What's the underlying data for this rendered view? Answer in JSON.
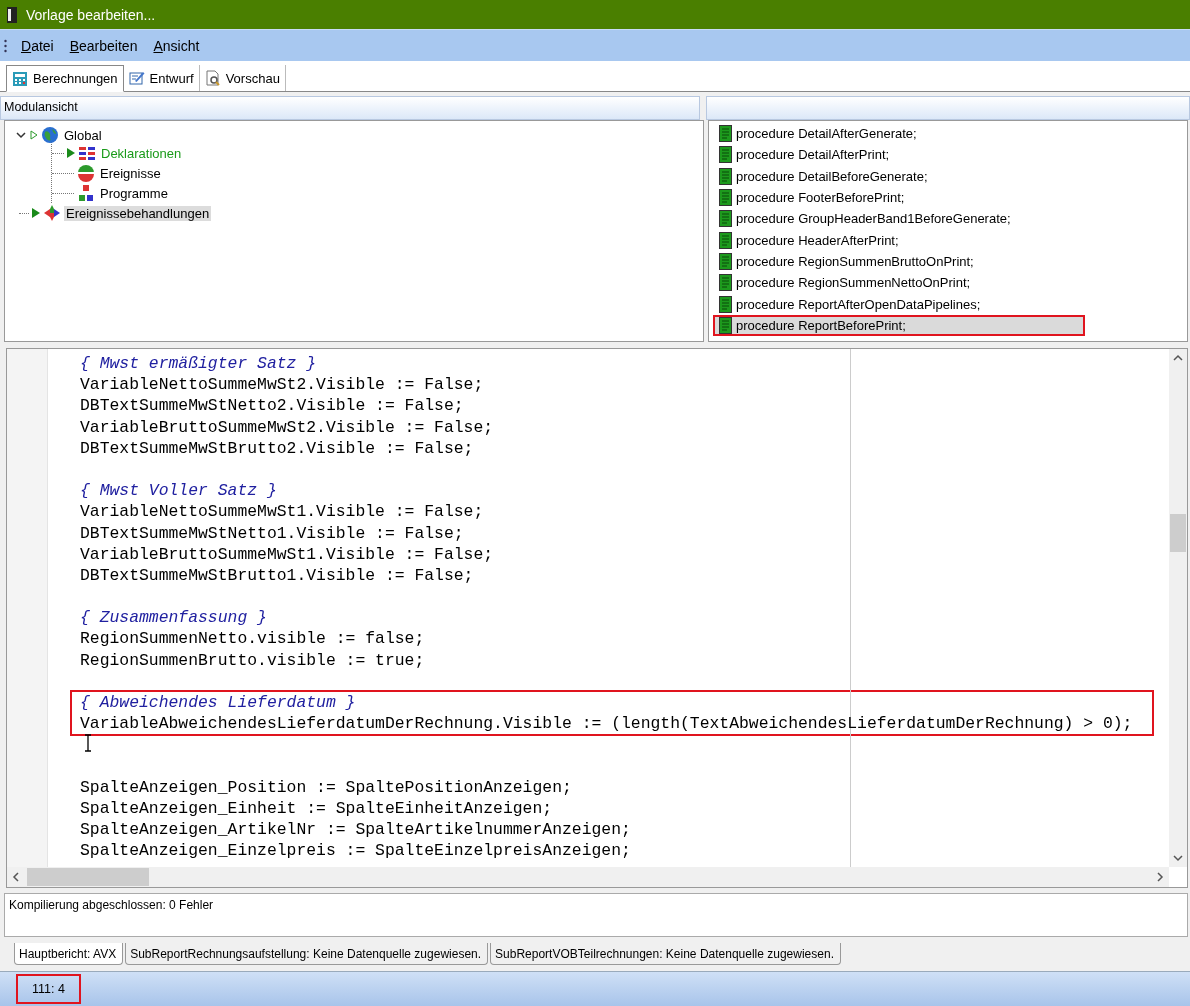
{
  "window": {
    "title": "Vorlage bearbeiten..."
  },
  "menu": [
    {
      "label": "Datei"
    },
    {
      "label": "Bearbeiten"
    },
    {
      "label": "Ansicht"
    }
  ],
  "tabs": [
    {
      "label": "Berechnungen",
      "selected": true
    },
    {
      "label": "Entwurf",
      "selected": false
    },
    {
      "label": "Vorschau",
      "selected": false
    }
  ],
  "module_view": {
    "title": "Modulansicht",
    "tree": [
      {
        "label": "Global",
        "expanded": true,
        "current": false,
        "selected": false,
        "children": [
          {
            "label": "Deklarationen",
            "current": true,
            "selected": false
          },
          {
            "label": "Ereignisse",
            "current": false,
            "selected": false
          },
          {
            "label": "Programme",
            "current": false,
            "selected": false
          }
        ]
      },
      {
        "label": "Ereignissebehandlungen",
        "current": false,
        "selected": true
      }
    ]
  },
  "procedures": [
    {
      "label": "procedure DetailAfterGenerate;",
      "selected": false,
      "highlighted": false
    },
    {
      "label": "procedure DetailAfterPrint;",
      "selected": false,
      "highlighted": false
    },
    {
      "label": "procedure DetailBeforeGenerate;",
      "selected": false,
      "highlighted": false
    },
    {
      "label": "procedure FooterBeforePrint;",
      "selected": false,
      "highlighted": false
    },
    {
      "label": "procedure GroupHeaderBand1BeforeGenerate;",
      "selected": false,
      "highlighted": false
    },
    {
      "label": "procedure HeaderAfterPrint;",
      "selected": false,
      "highlighted": false
    },
    {
      "label": "procedure RegionSummenBruttoOnPrint;",
      "selected": false,
      "highlighted": false
    },
    {
      "label": "procedure RegionSummenNettoOnPrint;",
      "selected": false,
      "highlighted": false
    },
    {
      "label": "procedure ReportAfterOpenDataPipelines;",
      "selected": false,
      "highlighted": false
    },
    {
      "label": "procedure ReportBeforePrint;",
      "selected": true,
      "highlighted": true
    }
  ],
  "code": {
    "blocks": [
      {
        "lines": [
          {
            "kind": "comment",
            "text": "{ Mwst ermäßigter Satz }"
          },
          {
            "kind": "code",
            "text": "VariableNettoSummeMwSt2.Visible := False;"
          },
          {
            "kind": "code",
            "text": "DBTextSummeMwStNetto2.Visible := False;"
          },
          {
            "kind": "code",
            "text": "VariableBruttoSummeMwSt2.Visible := False;"
          },
          {
            "kind": "code",
            "text": "DBTextSummeMwStBrutto2.Visible := False;"
          },
          {
            "kind": "blank"
          },
          {
            "kind": "comment",
            "text": "{ Mwst Voller Satz }"
          },
          {
            "kind": "code",
            "text": "VariableNettoSummeMwSt1.Visible := False;"
          },
          {
            "kind": "code",
            "text": "DBTextSummeMwStNetto1.Visible := False;"
          },
          {
            "kind": "code",
            "text": "VariableBruttoSummeMwSt1.Visible := False;"
          },
          {
            "kind": "code",
            "text": "DBTextSummeMwStBrutto1.Visible := False;"
          },
          {
            "kind": "blank"
          },
          {
            "kind": "comment",
            "text": "{ Zusammenfassung }"
          },
          {
            "kind": "code",
            "text": "RegionSummenNetto.visible := false;"
          },
          {
            "kind": "code",
            "text": "RegionSummenBrutto.visible := true;"
          },
          {
            "kind": "blank"
          }
        ]
      },
      {
        "highlighted": true,
        "lines": [
          {
            "kind": "comment",
            "text": "{ Abweichendes Lieferdatum }"
          },
          {
            "kind": "code",
            "text": "VariableAbweichendesLieferdatumDerRechnung.Visible := (length(TextAbweichendesLieferdatumDerRechnung) > 0);"
          }
        ]
      },
      {
        "lines": [
          {
            "kind": "cursor"
          },
          {
            "kind": "blank"
          },
          {
            "kind": "code",
            "text": "SpalteAnzeigen_Position := SpaltePositionAnzeigen;"
          },
          {
            "kind": "code",
            "text": "SpalteAnzeigen_Einheit := SpalteEinheitAnzeigen;"
          },
          {
            "kind": "code",
            "text": "SpalteAnzeigen_ArtikelNr := SpalteArtikelnummerAnzeigen;"
          },
          {
            "kind": "code",
            "text": "SpalteAnzeigen_Einzelpreis := SpalteEinzelpreisAnzeigen;"
          }
        ]
      }
    ]
  },
  "messages": [
    "Kompilierung abgeschlossen: 0 Fehler"
  ],
  "report_tabs": [
    {
      "label": "Hauptbericht: AVX",
      "selected": true
    },
    {
      "label": "SubReportRechnungsaufstellung: Keine Datenquelle zugewiesen.",
      "selected": false
    },
    {
      "label": "SubReportVOBTeilrechnungen: Keine Datenquelle zugewiesen.",
      "selected": false
    }
  ],
  "status_bar": {
    "position": "111: 4",
    "highlighted": true
  }
}
